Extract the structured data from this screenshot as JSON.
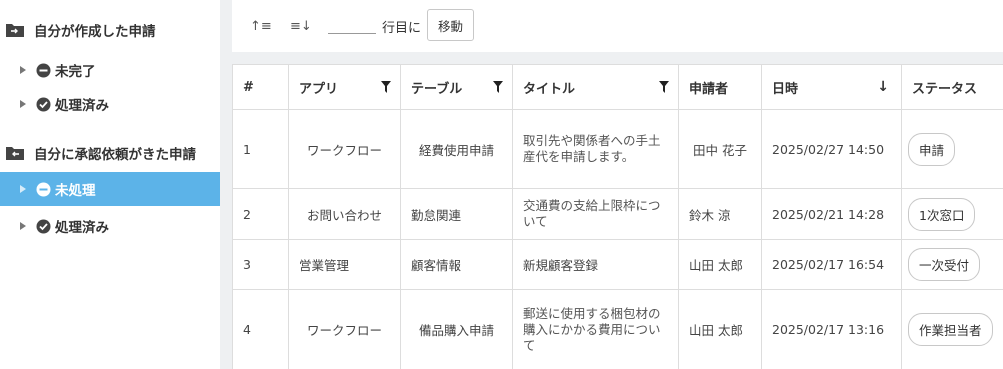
{
  "sidebar": {
    "groups": [
      {
        "label": "自分が作成した申請",
        "items": [
          {
            "label": "未完了",
            "icon": "minus-circle-icon"
          },
          {
            "label": "処理済み",
            "icon": "check-circle-icon"
          }
        ]
      },
      {
        "label": "自分に承認依頼がきた申請",
        "items": [
          {
            "label": "未処理",
            "icon": "minus-circle-icon"
          },
          {
            "label": "処理済み",
            "icon": "check-circle-icon"
          }
        ]
      }
    ],
    "active_color": "#5cb3e8"
  },
  "toolbar": {
    "sort_asc_icon": "↑≡",
    "sort_desc_icon": "≡↓",
    "row_value": "",
    "row_label": "行目に",
    "move_label": "移動"
  },
  "table": {
    "headers": {
      "num": "#",
      "app": "アプリ",
      "table": "テーブル",
      "title": "タイトル",
      "applicant": "申請者",
      "date": "日時",
      "status": "ステータス"
    },
    "rows": [
      {
        "num": "1",
        "app": "ワークフロー",
        "table": "経費使用申請",
        "title": "取引先や関係者への手土産代を申請します。",
        "applicant": "田中 花子",
        "date": "2025/02/27 14:50",
        "status": "申請"
      },
      {
        "num": "2",
        "app": "お問い合わせ",
        "table": "勤怠関連",
        "title": "交通費の支給上限枠について",
        "applicant": "鈴木 涼",
        "date": "2025/02/21 14:28",
        "status": "1次窓口"
      },
      {
        "num": "3",
        "app": "営業管理",
        "table": "顧客情報",
        "title": "新規顧客登録",
        "applicant": "山田 太郎",
        "date": "2025/02/17 16:54",
        "status": "一次受付"
      },
      {
        "num": "4",
        "app": "ワークフロー",
        "table": "備品購入申請",
        "title": "郵送に使用する梱包材の購入にかかる費用について",
        "applicant": "山田 太郎",
        "date": "2025/02/17 13:16",
        "status": "作業担当者"
      }
    ]
  }
}
